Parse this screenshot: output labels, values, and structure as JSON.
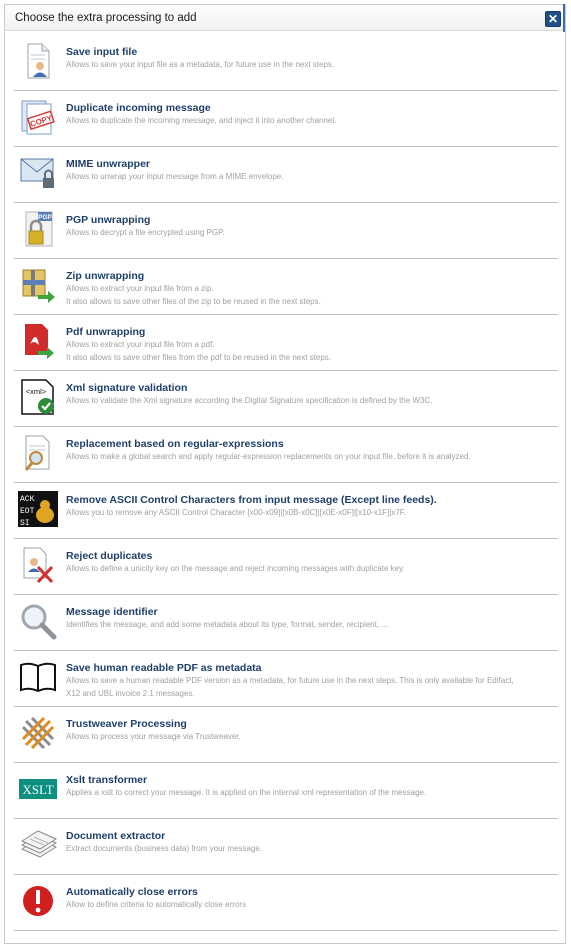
{
  "dialog": {
    "title": "Choose the extra processing to add",
    "close_icon": "close-icon"
  },
  "items": [
    {
      "key": "save-input-file",
      "icon": "document-user-icon",
      "title": "Save input file",
      "desc": [
        "Allows to save your input file as a metadata, for future use in the next steps."
      ]
    },
    {
      "key": "duplicate-incoming-message",
      "icon": "copy-stamp-icon",
      "title": "Duplicate incoming message",
      "desc": [
        "Allows to duplicate the incoming message, and inject it into another channel."
      ]
    },
    {
      "key": "mime-unwrapper",
      "icon": "envelope-lock-icon",
      "title": "MIME unwrapper",
      "desc": [
        "Allows to unwrap your input message from a MIME envelope."
      ]
    },
    {
      "key": "pgp-unwrapping",
      "icon": "pgp-lock-icon",
      "title": "PGP unwrapping",
      "desc": [
        "Allows to decrypt a file encrypted using PGP."
      ]
    },
    {
      "key": "zip-unwrapping",
      "icon": "zip-archive-icon",
      "title": "Zip unwrapping",
      "desc": [
        "Allows to extract your input file from a zip.",
        "It also allows to save other files of the zip to be reused in the next steps."
      ]
    },
    {
      "key": "pdf-unwrapping",
      "icon": "pdf-extract-icon",
      "title": "Pdf unwrapping",
      "desc": [
        "Allows to extract your input file from a pdf.",
        "It also allows to save other files from the pdf to be reused in the next steps."
      ]
    },
    {
      "key": "xml-signature-validation",
      "icon": "xml-check-icon",
      "title": "Xml signature validation",
      "desc": [
        "Allows to validate the Xml signature according the Digital Signature specification is defined by the W3C."
      ]
    },
    {
      "key": "replacement-regex",
      "icon": "document-search-icon",
      "title": "Replacement based on regular-expressions",
      "desc": [
        "Allows to make a global search and apply regular-expression replacements on your input file, before it is analyzed."
      ]
    },
    {
      "key": "remove-ascii-control",
      "icon": "ascii-characters-icon",
      "title": "Remove ASCII Control Characters from input message (Except line feeds).",
      "desc": [
        "Allows you to remove any ASCII Control Character [x00-x09]|[x0B-x0C]|[x0E-x0F]|[x10-x1F]|x7F."
      ]
    },
    {
      "key": "reject-duplicates",
      "icon": "document-reject-icon",
      "title": "Reject duplicates",
      "desc": [
        "Allows to define a unicity key on the message and reject incoming messages with duplicate key."
      ]
    },
    {
      "key": "message-identifier",
      "icon": "magnifier-icon",
      "title": "Message identifier",
      "desc": [
        "Identifies the message, and add some metadata about its type, format, sender, recipient, ..."
      ]
    },
    {
      "key": "save-human-readable-pdf",
      "icon": "open-book-icon",
      "title": "Save human readable PDF as metadata",
      "desc": [
        "Allows to save a human readable PDF version as a metadata, for future use in the next steps. This is only available for Edifact,",
        "X12 and UBL invoice 2.1 messages."
      ]
    },
    {
      "key": "trustweaver-processing",
      "icon": "trustweaver-icon",
      "title": "Trustweaver Processing",
      "desc": [
        "Allows to process your message via Trustweaver."
      ]
    },
    {
      "key": "xslt-transformer",
      "icon": "xslt-icon",
      "title": "Xslt transformer",
      "desc": [
        "Applies a xslt to correct your message. It is applied on the internal xml representation of the message."
      ]
    },
    {
      "key": "document-extractor",
      "icon": "documents-stack-icon",
      "title": "Document extractor",
      "desc": [
        "Extract documents (business data) from your message."
      ]
    },
    {
      "key": "automatically-close-errors",
      "icon": "error-icon",
      "title": "Automatically close errors",
      "desc": [
        "Allow to define criteria to automatically close errors"
      ]
    }
  ],
  "icon_text": {
    "copy": "COPY",
    "pgp": "PGP",
    "xml": "<xml>",
    "xslt": "XSLT",
    "ascii": [
      "ACK",
      "EOT",
      "SI"
    ]
  }
}
